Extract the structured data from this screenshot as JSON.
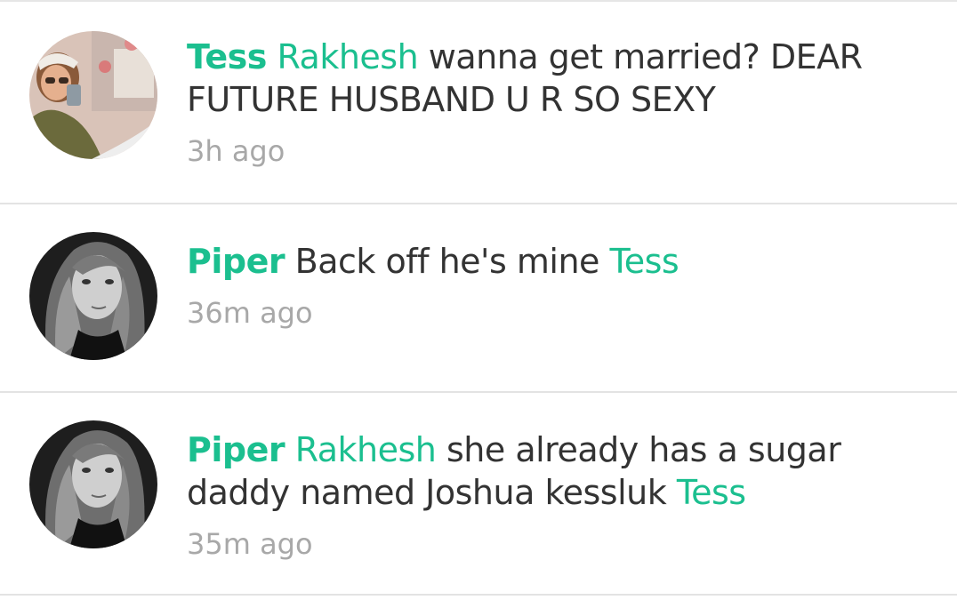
{
  "colors": {
    "accent": "#1bbf8f",
    "text": "#333333",
    "muted": "#a8a8a8",
    "divider": "#e3e3e3"
  },
  "comments": [
    {
      "author": "Tess",
      "mention": "Rakhesh",
      "text": " wanna get married? DEAR FUTURE HUSBAND U R SO SEXY",
      "time": "3h ago",
      "avatar": "selfie-photo"
    },
    {
      "author": "Piper",
      "text": " Back off he's mine ",
      "mention_end": "Tess",
      "time": "36m ago",
      "avatar": "bw-portrait-photo"
    },
    {
      "author": "Piper",
      "mention": "Rakhesh",
      "text": " she already has a sugar daddy named Joshua kessluk ",
      "mention_end": "Tess",
      "time": "35m ago",
      "avatar": "bw-portrait-photo"
    }
  ]
}
